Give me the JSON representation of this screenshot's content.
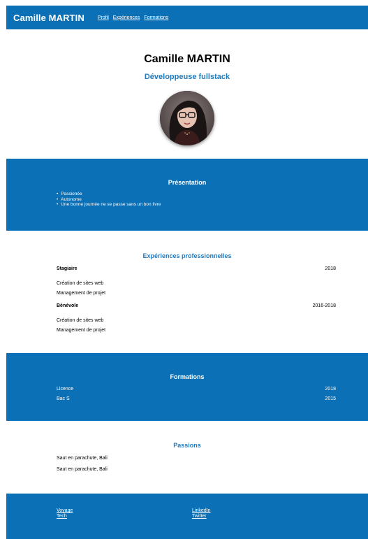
{
  "header": {
    "brand": "Camille MARTIN",
    "nav": [
      "Profil",
      "Expériences",
      "Formations"
    ]
  },
  "hero": {
    "name": "Camille MARTIN",
    "role": "Développeuse fullstack"
  },
  "presentation": {
    "title": "Présentation",
    "items": [
      "Passionée",
      "Autonome",
      "Une bonne journée ne se passe sans un bon livre"
    ]
  },
  "experiences": {
    "title": "Expériences professionnelles",
    "jobs": [
      {
        "title": "Stagiaire",
        "year": "2018",
        "details": [
          "Création de sites web",
          "Management de projet"
        ]
      },
      {
        "title": "Bénévole",
        "year": "2016-2018",
        "details": [
          "Création de sites web",
          "Management de projet"
        ]
      }
    ]
  },
  "formations": {
    "title": "Formations",
    "items": [
      {
        "name": "Licence",
        "year": "2018"
      },
      {
        "name": "Bac S",
        "year": "2015"
      }
    ]
  },
  "passions": {
    "title": "Passions",
    "items": [
      "Saut en parachute, Bali",
      "Saut en parachute, Bali"
    ]
  },
  "footer": {
    "left_links": [
      "Voyage",
      "Tech"
    ],
    "right_links": [
      "LinkedIn",
      "Twitter"
    ]
  },
  "colors": {
    "primary_blue": "#0b70b5",
    "accent_blue": "#1f7ac0"
  }
}
